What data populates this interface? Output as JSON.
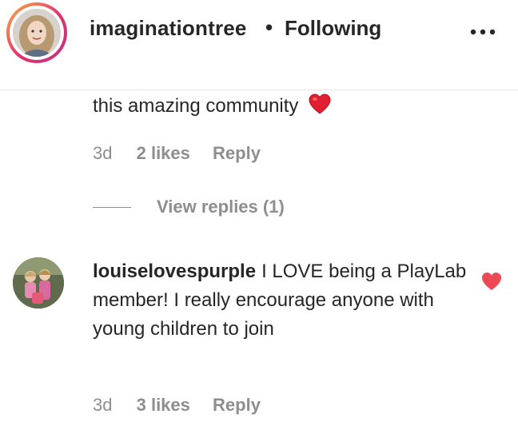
{
  "header": {
    "username": "imaginationtree",
    "separator": "•",
    "follow_status": "Following"
  },
  "comment1": {
    "text": "this amazing community",
    "emoji": "red-heart",
    "time": "3d",
    "likes": "2 likes",
    "reply": "Reply",
    "view_replies": "View replies (1)"
  },
  "comment2": {
    "username": "louiselovespurple",
    "text": "I LOVE being a PlayLab member! I really encourage anyone with young children to join",
    "liked": true,
    "time": "3d",
    "likes": "3 likes",
    "reply": "Reply"
  },
  "colors": {
    "text": "#262626",
    "muted": "#8e8e8e",
    "like_red": "#ed4956",
    "divider": "#e6e6e6"
  },
  "icons": [
    "more-options-icon",
    "red-heart-emoji",
    "liked-heart-icon"
  ]
}
